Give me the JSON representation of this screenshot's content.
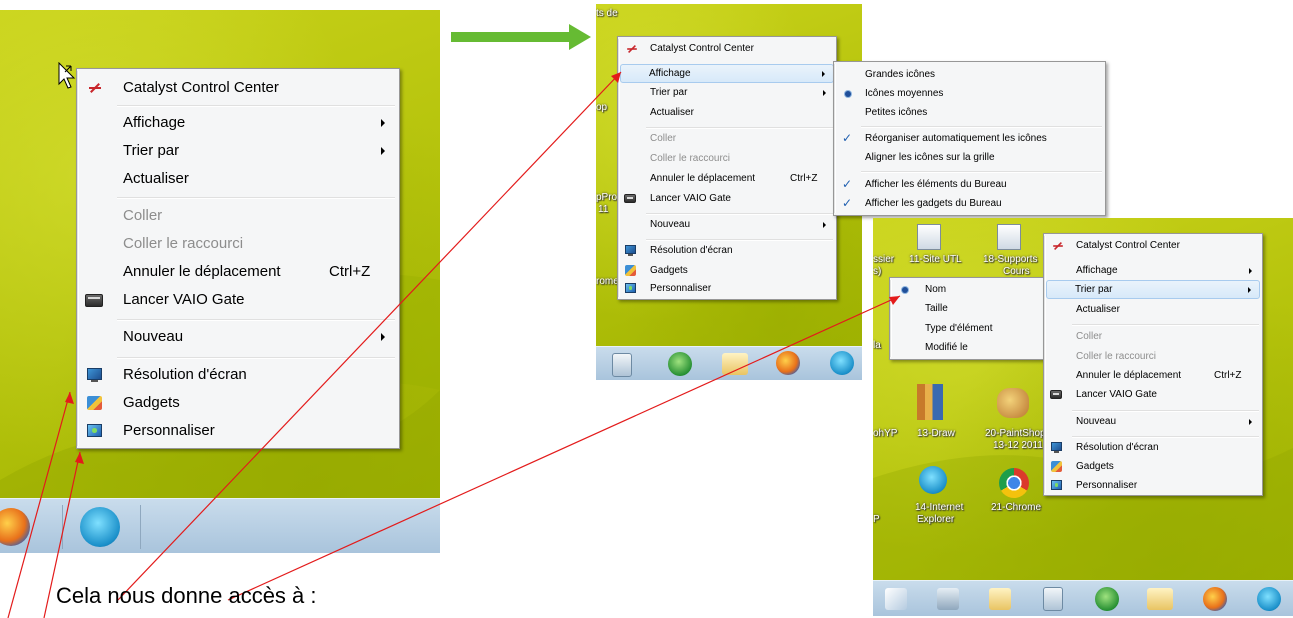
{
  "caption": "Cela nous donne accès à :",
  "colors": {
    "desktop": "#b5c30c",
    "taskbar": "#b9d0e4",
    "menu_bg": "#f5f6f7",
    "annotation_arrow": "#66bb33",
    "pointer_lines": "#e31b1b"
  },
  "context_menu": {
    "items": {
      "catalyst": "Catalyst Control Center",
      "affichage": "Affichage",
      "trier": "Trier par",
      "actualiser": "Actualiser",
      "coller": "Coller",
      "coller_raccourci": "Coller le raccourci",
      "annuler": "Annuler le déplacement",
      "annuler_shortcut": "Ctrl+Z",
      "vaio": "Lancer VAIO Gate",
      "nouveau": "Nouveau",
      "resolution": "Résolution d'écran",
      "gadgets": "Gadgets",
      "personnaliser": "Personnaliser"
    }
  },
  "affichage_submenu": {
    "grandes": "Grandes icônes",
    "moyennes": "Icônes moyennes",
    "petites": "Petites icônes",
    "reorganiser": "Réorganiser automatiquement les icônes",
    "aligner": "Aligner les icônes sur la grille",
    "elements": "Afficher les éléments du Bureau",
    "gadgets": "Afficher les gadgets du Bureau"
  },
  "trier_submenu": {
    "nom": "Nom",
    "taille": "Taille",
    "type": "Type d'élément",
    "modifie": "Modifié le"
  },
  "desktop_fragments": {
    "p2_top": "ts de",
    "p2_a": "op",
    "p2_b": "pPro",
    "p2_b2": "11",
    "p2_c": "rome"
  },
  "desktop_icons": {
    "ssier": "ssier",
    "ssier2": "s)",
    "site_utl": "11-Site UTL",
    "supports": "18-Supports",
    "supports2": "Cours",
    "la": "la",
    "ohyp": "ohYP",
    "draw": "13-Draw",
    "paintshop": "20-PaintShop",
    "paintshop2": "13-12 2011",
    "ie": "14-Internet",
    "ie2": "Explorer",
    "chrome": "21-Chrome",
    "p": "P"
  },
  "icons": [
    "mouse-pointer-icon",
    "catalyst-icon",
    "vaio-gate-icon",
    "screen-resolution-icon",
    "gadgets-icon",
    "personalize-icon",
    "firefox-icon",
    "internet-explorer-icon",
    "excel-icon",
    "folder-icon",
    "calculator-icon",
    "powerpoint-icon",
    "paint-icon",
    "chrome-icon",
    "checkmark-icon",
    "radio-dot-icon",
    "submenu-arrow-icon"
  ]
}
